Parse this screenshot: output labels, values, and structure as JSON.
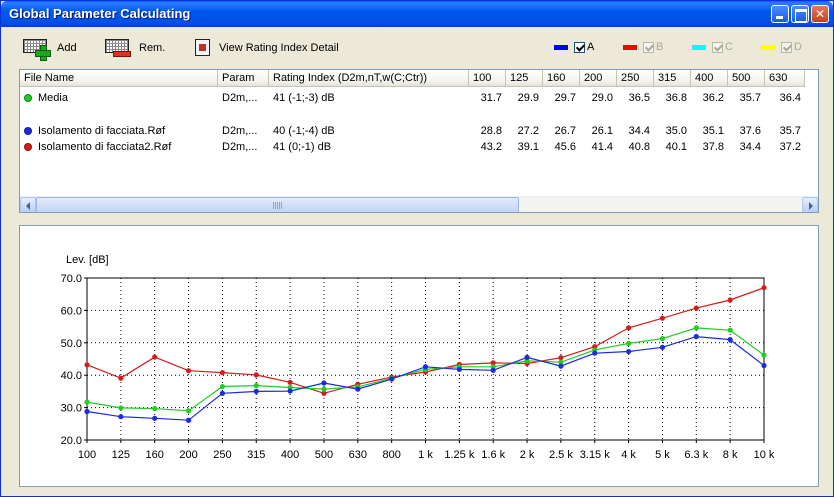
{
  "window": {
    "title": "Global Parameter Calculating"
  },
  "toolbar": {
    "add_label": "Add",
    "rem_label": "Rem.",
    "view_label": "View Rating Index Detail",
    "series_toggles": [
      {
        "label": "A",
        "color": "#0000FF",
        "checked": true,
        "enabled": true
      },
      {
        "label": "B",
        "color": "#FF0000",
        "checked": true,
        "enabled": false
      },
      {
        "label": "C",
        "color": "#00FFFF",
        "checked": true,
        "enabled": false
      },
      {
        "label": "D",
        "color": "#FFFF00",
        "checked": true,
        "enabled": false
      }
    ]
  },
  "table": {
    "columns": [
      "File Name",
      "Param",
      "Rating Index (D2m,nT,w(C;Ctr))",
      "100",
      "125",
      "160",
      "200",
      "250",
      "315",
      "400",
      "500",
      "630"
    ],
    "rows": [
      {
        "color": "#22CC22",
        "name": "Media",
        "param": "D2m,...",
        "rating": "41 (-1;-3) dB",
        "values": [
          "31.7",
          "29.9",
          "29.7",
          "29.0",
          "36.5",
          "36.8",
          "36.2",
          "35.7",
          "36.4"
        ]
      },
      {
        "color": "#1A2BE0",
        "name": "Isolamento di facciata.Røf",
        "param": "D2m,...",
        "rating": "40 (-1;-4) dB",
        "values": [
          "28.8",
          "27.2",
          "26.7",
          "26.1",
          "34.4",
          "35.0",
          "35.1",
          "37.6",
          "35.7"
        ]
      },
      {
        "color": "#D41C1C",
        "name": "Isolamento di facciata2.Røf",
        "param": "D2m,...",
        "rating": "41 (0;-1) dB",
        "values": [
          "43.2",
          "39.1",
          "45.6",
          "41.4",
          "40.8",
          "40.1",
          "37.8",
          "34.4",
          "37.2"
        ]
      }
    ]
  },
  "chart_data": {
    "type": "line",
    "ylabel": "Lev. [dB]",
    "ylim": [
      20,
      70
    ],
    "yticks": [
      "20.0",
      "30.0",
      "40.0",
      "50.0",
      "60.0",
      "70.0"
    ],
    "x": [
      "100",
      "125",
      "160",
      "200",
      "250",
      "315",
      "400",
      "500",
      "630",
      "800",
      "1 k",
      "1.25 k",
      "1.6 k",
      "2 k",
      "2.5 k",
      "3.15 k",
      "4 k",
      "5 k",
      "6.3 k",
      "8 k",
      "10 k"
    ],
    "grid": true,
    "series": [
      {
        "color": "#D41C1C",
        "values": [
          43.2,
          39.1,
          45.6,
          41.4,
          40.8,
          40.1,
          37.8,
          34.4,
          37.2,
          39.4,
          41.0,
          43.3,
          43.8,
          43.6,
          45.4,
          48.8,
          54.6,
          57.6,
          60.7,
          63.2,
          67.0
        ]
      },
      {
        "color": "#22CC22",
        "values": [
          31.7,
          29.9,
          29.7,
          29.0,
          36.5,
          36.8,
          36.2,
          35.7,
          36.4,
          39.0,
          41.8,
          42.6,
          42.6,
          44.4,
          44.0,
          47.8,
          49.8,
          51.3,
          54.6,
          53.9,
          46.2
        ]
      },
      {
        "color": "#1A2BE0",
        "values": [
          28.8,
          27.2,
          26.7,
          26.1,
          34.4,
          35.0,
          35.1,
          37.6,
          35.7,
          38.8,
          42.6,
          41.8,
          41.5,
          45.5,
          42.8,
          46.8,
          47.3,
          48.6,
          51.9,
          51.0,
          43.0
        ]
      }
    ]
  }
}
